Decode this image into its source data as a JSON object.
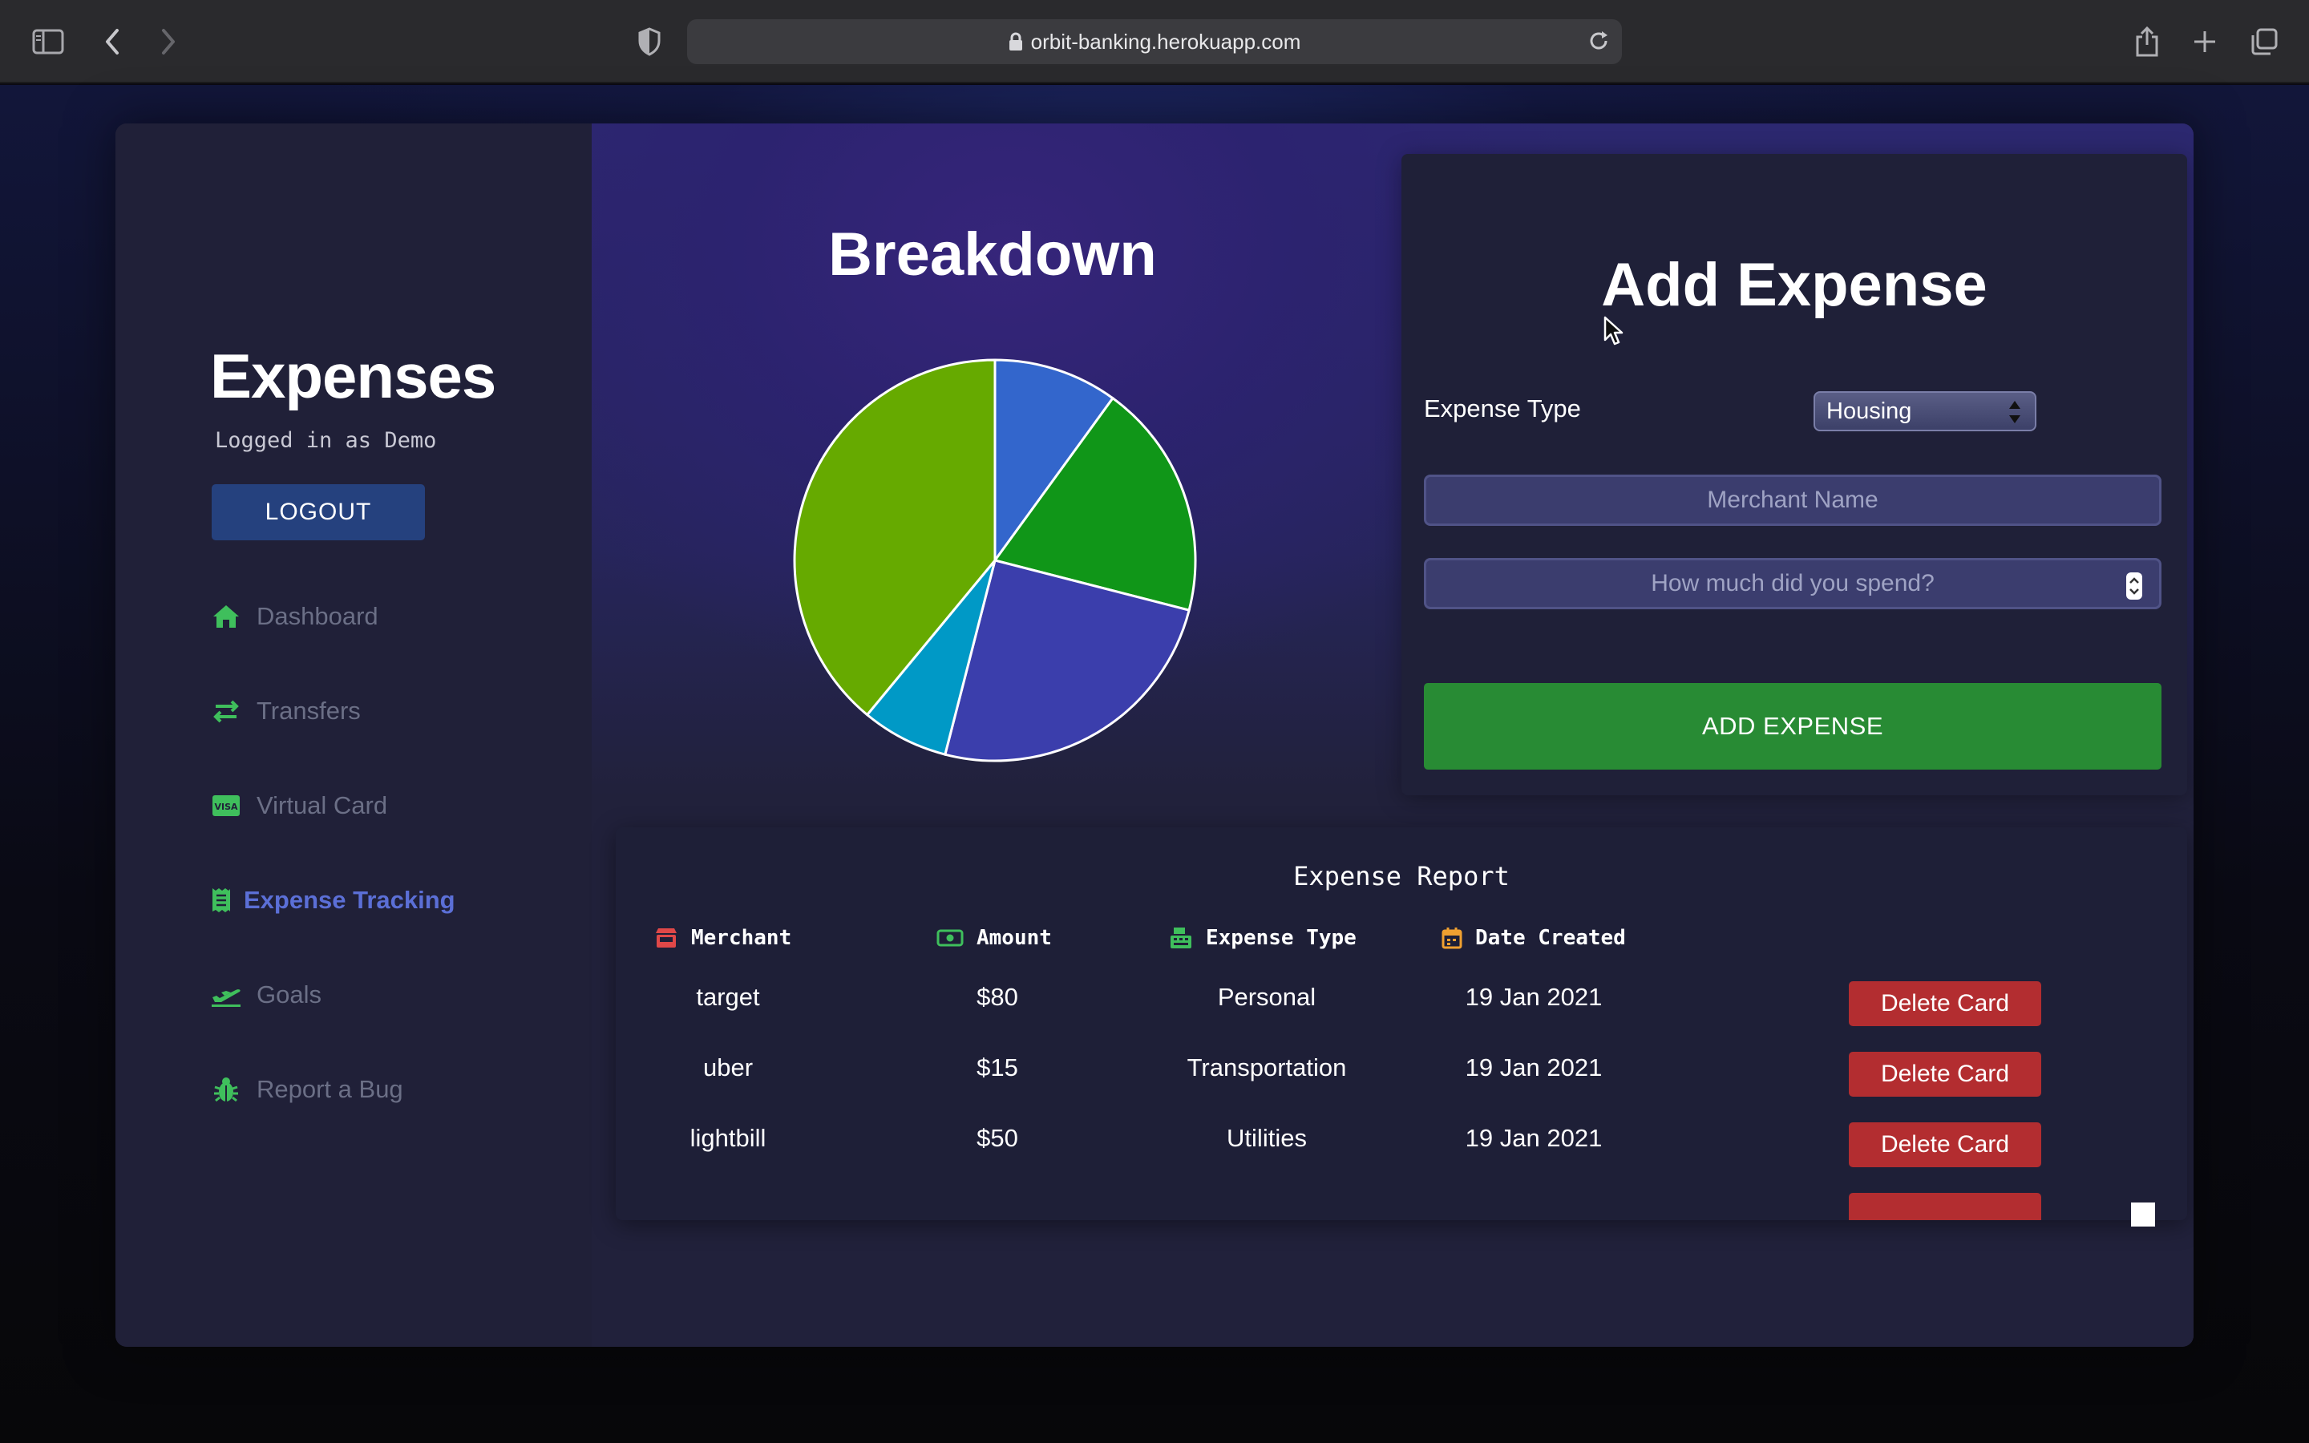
{
  "browser": {
    "url": "orbit-banking.herokuapp.com"
  },
  "sidebar": {
    "title": "Expenses",
    "subtitle": "Logged in as Demo",
    "logout_label": "LOGOUT",
    "items": [
      {
        "label": "Dashboard",
        "icon": "home-icon"
      },
      {
        "label": "Transfers",
        "icon": "transfer-arrows-icon"
      },
      {
        "label": "Virtual Card",
        "icon": "visa-card-icon"
      },
      {
        "label": "Expense Tracking",
        "icon": "receipt-icon",
        "active": true
      },
      {
        "label": "Goals",
        "icon": "plane-takeoff-icon"
      },
      {
        "label": "Report a Bug",
        "icon": "bug-icon"
      }
    ]
  },
  "breakdown": {
    "title": "Breakdown"
  },
  "chart_data": {
    "type": "pie",
    "title": "Breakdown",
    "legend": "none",
    "slices": [
      {
        "value": 10,
        "color": "#3366cc"
      },
      {
        "value": 19,
        "color": "#109618"
      },
      {
        "value": 25,
        "color": "#3b3eac"
      },
      {
        "value": 7,
        "color": "#0099c6"
      },
      {
        "value": 39,
        "color": "#66aa00"
      }
    ]
  },
  "add_expense": {
    "title": "Add Expense",
    "type_label": "Expense Type",
    "type_selected": "Housing",
    "merchant_placeholder": "Merchant Name",
    "amount_placeholder": "How much did you spend?",
    "submit_label": "ADD EXPENSE"
  },
  "report": {
    "title": "Expense Report",
    "columns": [
      {
        "label": "Merchant",
        "icon": "store-icon",
        "color": "#e04848"
      },
      {
        "label": "Amount",
        "icon": "money-icon",
        "color": "#3fbf5c"
      },
      {
        "label": "Expense Type",
        "icon": "cash-register-icon",
        "color": "#3fbf5c"
      },
      {
        "label": "Date Created",
        "icon": "calendar-icon",
        "color": "#f0a030"
      }
    ],
    "delete_label": "Delete Card",
    "rows": [
      {
        "merchant": "target",
        "amount": "$80",
        "type": "Personal",
        "date": "19 Jan 2021"
      },
      {
        "merchant": "uber",
        "amount": "$15",
        "type": "Transportation",
        "date": "19 Jan 2021"
      },
      {
        "merchant": "lightbill",
        "amount": "$50",
        "type": "Utilities",
        "date": "19 Jan 2021"
      }
    ]
  },
  "colors": {
    "accent_active": "#5b6fd6",
    "nav_icon": "#3fbf5c",
    "add_button": "#288b34",
    "delete_button": "#b32d30",
    "logout_button": "#25417e"
  }
}
